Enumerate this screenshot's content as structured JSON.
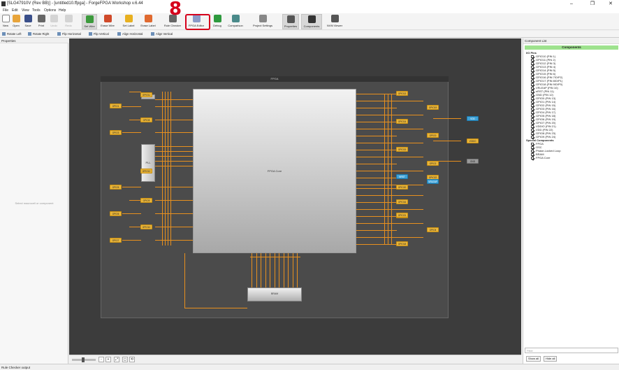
{
  "window": {
    "title": "[SLG47910V (Rev BB)] - [untitled10.ffpga] - ForgeFPGA Workshop v.6.44",
    "min": "–",
    "max": "❐",
    "close": "✕"
  },
  "menu": [
    "File",
    "Edit",
    "View",
    "Tools",
    "Options",
    "Help"
  ],
  "toolbar": [
    {
      "label": "New",
      "icon": "new-file-icon",
      "color": "#ffffff"
    },
    {
      "label": "Open",
      "icon": "folder-icon",
      "color": "#e8a43a"
    },
    {
      "label": "Save",
      "icon": "save-icon",
      "color": "#3a4f8a"
    },
    {
      "label": "Print",
      "icon": "print-icon",
      "color": "#666666"
    },
    {
      "label": "Undo",
      "icon": "undo-icon",
      "color": "#999999",
      "disabled": true
    },
    {
      "label": "Redo",
      "icon": "redo-icon",
      "color": "#999999",
      "disabled": true
    },
    {
      "label": "Set Wire",
      "icon": "wire-icon",
      "color": "#3c9a3c",
      "active": true
    },
    {
      "label": "Erase Wire",
      "icon": "erase-wire-icon",
      "color": "#d04a2a"
    },
    {
      "label": "Set Label",
      "icon": "label-icon",
      "color": "#e8b020"
    },
    {
      "label": "Erase Label",
      "icon": "erase-label-icon",
      "color": "#e06a30"
    },
    {
      "label": "Rule Checker",
      "icon": "rule-checker-icon",
      "color": "#666666"
    },
    {
      "label": "FPGA Editor",
      "icon": "fpga-editor-icon",
      "color": "#8a9ac8"
    },
    {
      "label": "Debug",
      "icon": "debug-icon",
      "color": "#2e9a3e"
    },
    {
      "label": "Comparison",
      "icon": "comparison-icon",
      "color": "#4a8a8a"
    },
    {
      "label": "Project Settings",
      "icon": "settings-icon",
      "color": "#888888"
    },
    {
      "label": "Properties",
      "icon": "properties-icon",
      "color": "#555555",
      "active": true
    },
    {
      "label": "Components",
      "icon": "components-icon",
      "color": "#333333",
      "active": true
    },
    {
      "label": "NVM Viewer",
      "icon": "nvm-icon",
      "color": "#555555"
    }
  ],
  "annotation": {
    "step": "8"
  },
  "toolbar2": [
    "Rotate Left",
    "Rotate Right",
    "Flip Horizontal",
    "Flip Vertical",
    "Align Horizontal",
    "Align Vertical"
  ],
  "properties": {
    "header": "Properties",
    "empty_text": "Select macrocell or component"
  },
  "fpga": {
    "title": "FPGA",
    "core_label": "FPGA Core",
    "pll_label": "PLL",
    "osc_label": "OSC",
    "bram_label": "BRAM"
  },
  "pins_left": [
    "GPIO1",
    "GPIO3",
    "GPIO5",
    "GPIO6",
    "GPIO7",
    "GPIO8",
    "GPIO9",
    "GPIO10",
    "GPIO11",
    "GPIO12"
  ],
  "pins_right": [
    "GPIO13",
    "GPIO14",
    "GPIO15",
    "GPIO16",
    "GPIO17",
    "GPIO18",
    "GPIO19",
    "GPIO0",
    "GPIO2",
    "GPIO4",
    "GPIO20",
    "GPIO21",
    "GPIO22"
  ],
  "pins_special": {
    "nrst": "NRST",
    "vddio": "VDDIO",
    "vdd": "VDD",
    "gnd": "GND",
    "vrleap": "VRLEAP"
  },
  "components": {
    "header": "Component List",
    "tab": "Components",
    "io_group": "I/O Pins",
    "io_items": [
      "GPIO10 (PIN 1)",
      "GPIO11 (PIN 2)",
      "GPIO12 (PIN 3)",
      "GPIO13 (PIN 4)",
      "GPIO14 (PIN 5)",
      "GPIO15 (PIN 6)",
      "GPIO16 (PIN 7/D/P2)",
      "GPIO17 (PIN 8/D/P1)",
      "GPIO18 (PIN 9/D/P0)",
      "VRLEAP (PIN 10)",
      "nRST (PIN 11)",
      "GND (PIN 12)",
      "GPIO0 (PIN 13)",
      "GPIO1 (PIN 14)",
      "GPIO2 (PIN 15)",
      "GPIO3 (PIN 16)",
      "GPIO4 (PIN 17)",
      "GPIO5 (PIN 18)",
      "GPIO6 (PIN 19)",
      "GPIO7 (PIN 20)",
      "VDDIO (PIN 21)",
      "VDD (PIN 22)",
      "GPIO8 (PIN 23)",
      "GPIO9 (PIN 24)"
    ],
    "special_group": "Special Components",
    "special_items": [
      "FPGA",
      "OSC",
      "Phase-Locked Loop",
      "BRAM",
      "FPGA Core"
    ],
    "filter_placeholder": "Filter",
    "show_all": "Show all",
    "hide_all": "Hide all"
  },
  "zoom_buttons": [
    "-",
    "+",
    "⤢",
    "◻",
    "⟲"
  ],
  "status": "Rule Checker output"
}
